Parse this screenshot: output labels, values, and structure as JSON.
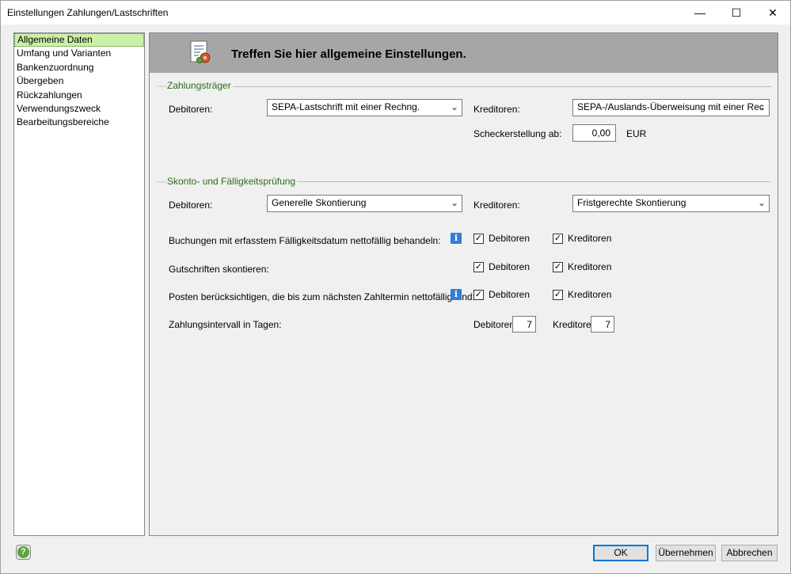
{
  "window": {
    "title": "Einstellungen Zahlungen/Lastschriften"
  },
  "titlebar_controls": {
    "minimize": "—",
    "maximize": "☐",
    "close": "✕"
  },
  "sidebar": {
    "items": [
      {
        "label": "Allgemeine Daten",
        "selected": true
      },
      {
        "label": "Umfang und Varianten"
      },
      {
        "label": "Bankenzuordnung"
      },
      {
        "label": "Übergeben"
      },
      {
        "label": "Rückzahlungen"
      },
      {
        "label": "Verwendungszweck"
      },
      {
        "label": "Bearbeitungsbereiche"
      }
    ]
  },
  "header": {
    "title": "Treffen Sie hier allgemeine Einstellungen."
  },
  "zahlungstraeger": {
    "group_label": "Zahlungsträger",
    "debitoren_label": "Debitoren:",
    "debitoren_value": "SEPA-Lastschrift mit einer Rechng.",
    "kreditoren_label": "Kreditoren:",
    "kreditoren_value": "SEPA-/Auslands-Überweisung mit einer Rec",
    "scheck_label": "Scheckerstellung ab:",
    "scheck_value": "0,00",
    "scheck_unit": "EUR"
  },
  "skonto": {
    "group_label": "Skonto- und Fälligkeitsprüfung",
    "debitoren_label": "Debitoren:",
    "debitoren_value": "Generelle Skontierung",
    "kreditoren_label": "Kreditoren:",
    "kreditoren_value": "Fristgerechte Skontierung",
    "rows": [
      {
        "label": "Buchungen mit erfasstem Fälligkeitsdatum nettofällig behandeln:",
        "info": "i",
        "deb_label": "Debitoren",
        "deb_checked": true,
        "kred_label": "Kreditoren",
        "kred_checked": true
      },
      {
        "label": "Gutschriften skontieren:",
        "deb_label": "Debitoren",
        "deb_checked": true,
        "kred_label": "Kreditoren",
        "kred_checked": true
      },
      {
        "label": "Posten berücksichtigen, die bis zum nächsten Zahltermin nettofällig sind:",
        "info": "i",
        "deb_label": "Debitoren",
        "deb_checked": true,
        "kred_label": "Kreditoren",
        "kred_checked": true
      }
    ],
    "intervall_label": "Zahlungsintervall in Tagen:",
    "intervall_deb_label": "Debitoren",
    "intervall_deb_value": "7",
    "intervall_kred_label": "Kreditoren",
    "intervall_kred_value": "7"
  },
  "footer": {
    "help": "?",
    "ok": "OK",
    "apply": "Übernehmen",
    "cancel": "Abbrechen"
  },
  "colors": {
    "accent_selected": "#ccf0a8",
    "group_label": "#2e6b1a",
    "header_bg": "#a6a6a6",
    "info_icon": "#2f7fd6"
  }
}
